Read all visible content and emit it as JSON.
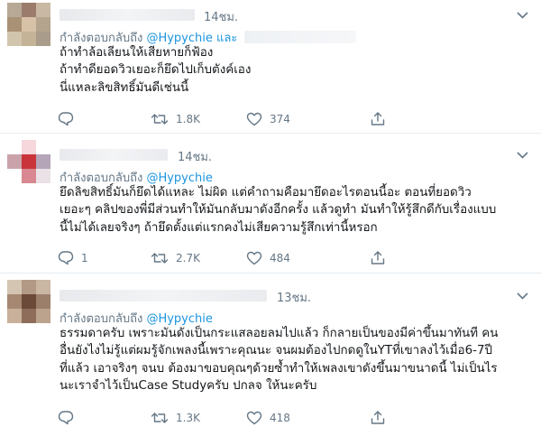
{
  "tweets": [
    {
      "time": "14ชม.",
      "reply_prefix": "กำลังตอบกลับถึง",
      "reply_handle": "@Hypychie",
      "reply_and": "และ",
      "lines": [
        "ถ้าทำล้อเลียนให้เสียหายก็ฟ้อง",
        "ถ้าทำดียอดวิวเยอะก็ยึดไปเก็บตังค์เอง",
        "นี่แหละลิขสิทธิ์มันดีเช่นนี้"
      ],
      "reply_count": "",
      "retweet_count": "1.8K",
      "like_count": "374"
    },
    {
      "time": "14ชม.",
      "reply_prefix": "กำลังตอบกลับถึง",
      "reply_handle": "@Hypychie",
      "lines": [
        "ยึดลิขสิทธิ์มันก็ยึดได้แหละ ไม่ผิด แต่คำถามคือมายึดอะไรตอนนี้อะ ตอนที่ยอดวิว",
        "เยอะๆ คลิปของพี่มีส่วนทำให้มันกลับมาดังอีกครั้ง แล้วดูทำ มันทำให้รู้สึกดีกับเรื่องแบบ",
        "นี้ไม่ได้เลยจริงๆ ถ้ายึดตั้งแต่แรกคงไม่เสียความรู้สึกเท่านี้หรอก"
      ],
      "reply_count": "1",
      "retweet_count": "2.7K",
      "like_count": "484"
    },
    {
      "time": "13ชม.",
      "reply_prefix": "กำลังตอบกลับถึง",
      "reply_handle": "@Hypychie",
      "lines": [
        "ธรรมดาครับ เพราะมันดังเป็นกระแสลอยลมไปแล้ว ก็กลายเป็นของมีค่าขึ้นมาทันที คน",
        "อื่นยังไงไม่รู้แต่ผมรู้จักเพลงนี้เพราะคุณนะ จนผมต้องไปกดดูในYTที่เขาลงไว้เมื่อ6-7ปี",
        "ที่แล้ว เอาจริงๆ จนบ ต้องมาขอบคุณๆด้วยซ้ำทำให้เพลงเขาดังขึ้นมาขนาดนี้ ไม่เป็นไร",
        "นะเราจำไว้เป็นCase Studyครับ ปกลจ ให้นะครับ"
      ],
      "reply_count": "",
      "retweet_count": "1.3K",
      "like_count": "418"
    }
  ],
  "icons": {
    "reply": "reply-icon",
    "retweet": "retweet-icon",
    "like": "heart-icon",
    "share": "share-icon",
    "menu": "chevron-down-icon"
  },
  "colors": {
    "text": "#14171a",
    "secondary": "#657786",
    "link": "#1b95e0",
    "divider": "#e6ecf0"
  }
}
